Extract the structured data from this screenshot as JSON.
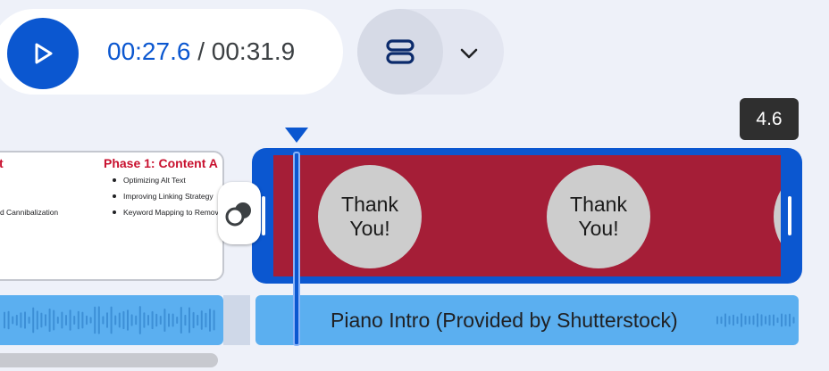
{
  "player": {
    "current_time": "00:27.6",
    "separator": " / ",
    "total_time": "00:31.9",
    "play_icon": "play-icon"
  },
  "layout": {
    "toggle_icon": "timeline-layout-icon",
    "dropdown_icon": "chevron-down-icon"
  },
  "timeline": {
    "selected_duration": "4.6",
    "slide_clip": {
      "heading_left": "udit",
      "heading_right": "Phase 1: Content A",
      "left_item": "yword Cannibalization",
      "items": [
        "Optimizing Alt Text",
        "Improving Linking Strategy",
        "Keyword Mapping to Remove"
      ]
    },
    "transition_icon": "transition-icon",
    "selected_clip": {
      "thumb_1": "Thank You!",
      "thumb_2": "Thank You!"
    },
    "audio": {
      "label": "Piano Intro (Provided by Shutterstock)"
    }
  },
  "colors": {
    "accent": "#0b57d0",
    "clip_fill": "#a51e37",
    "audio": "#5baff0",
    "slide_heading": "#c8102e"
  }
}
